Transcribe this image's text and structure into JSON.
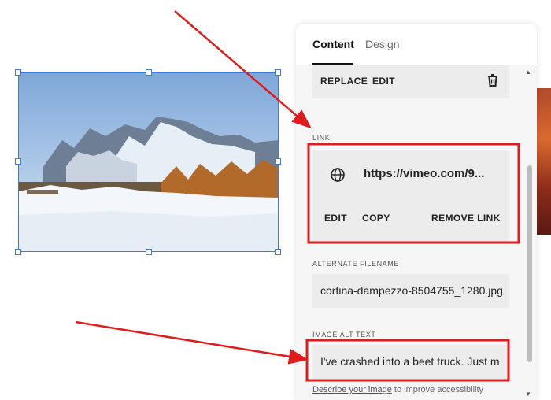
{
  "panel": {
    "tabs": [
      {
        "label": "Content"
      },
      {
        "label": "Design"
      }
    ],
    "toolbar": {
      "replace_label": "REPLACE",
      "edit_label": "EDIT",
      "delete_icon": "trash-icon"
    },
    "link": {
      "section_label": "LINK",
      "icon": "globe-icon",
      "url": "https://vimeo.com/9...",
      "edit_label": "EDIT",
      "copy_label": "COPY",
      "remove_label": "REMOVE LINK"
    },
    "filename": {
      "section_label": "ALTERNATE FILENAME",
      "value": "cortina-dampezzo-8504755_1280.jpg"
    },
    "alt_text": {
      "section_label": "IMAGE ALT TEXT",
      "value": "I've crashed into a beet truck. Just m",
      "help_link": "Describe your image",
      "help_text": " to improve accessibility"
    }
  },
  "annotations": {
    "highlight_color": "#e01b1b"
  },
  "canvas": {
    "image_subject": "snowy mountain landscape",
    "selection_color": "#3b7bd9"
  }
}
